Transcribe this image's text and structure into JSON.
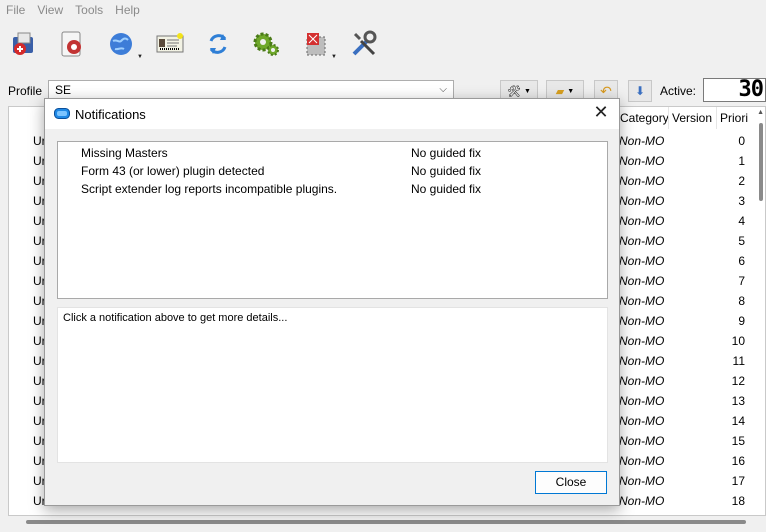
{
  "menu": {
    "items": [
      "File",
      "View",
      "Tools",
      "Help"
    ]
  },
  "toolbar": {
    "icons": [
      "install-mod-icon",
      "nexus-icon",
      "browser-icon",
      "profiles-icon",
      "refresh-icon",
      "settings-gears-icon",
      "executables-icon",
      "tools-icon"
    ]
  },
  "profile": {
    "label": "Profile",
    "value": "SE",
    "active_label": "Active:",
    "active_count": "30"
  },
  "modlist": {
    "columns": {
      "category": "Category",
      "version": "Version",
      "priority": "Priori"
    },
    "name_fragment": "Ur",
    "rows": [
      {
        "cat": "Non-MO",
        "pri": "0"
      },
      {
        "cat": "Non-MO",
        "pri": "1"
      },
      {
        "cat": "Non-MO",
        "pri": "2"
      },
      {
        "cat": "Non-MO",
        "pri": "3"
      },
      {
        "cat": "Non-MO",
        "pri": "4"
      },
      {
        "cat": "Non-MO",
        "pri": "5"
      },
      {
        "cat": "Non-MO",
        "pri": "6"
      },
      {
        "cat": "Non-MO",
        "pri": "7"
      },
      {
        "cat": "Non-MO",
        "pri": "8"
      },
      {
        "cat": "Non-MO",
        "pri": "9"
      },
      {
        "cat": "Non-MO",
        "pri": "10"
      },
      {
        "cat": "Non-MO",
        "pri": "11"
      },
      {
        "cat": "Non-MO",
        "pri": "12"
      },
      {
        "cat": "Non-MO",
        "pri": "13"
      },
      {
        "cat": "Non-MO",
        "pri": "14"
      },
      {
        "cat": "Non-MO",
        "pri": "15"
      },
      {
        "cat": "Non-MO",
        "pri": "16"
      },
      {
        "cat": "Non-MO",
        "pri": "17"
      },
      {
        "cat": "Non-MO",
        "pri": "18"
      }
    ]
  },
  "dialog": {
    "title": "Notifications",
    "notifications": [
      {
        "message": "Missing Masters",
        "fix": "No guided fix"
      },
      {
        "message": "Form 43 (or lower) plugin detected",
        "fix": "No guided fix"
      },
      {
        "message": "Script extender log reports incompatible plugins.",
        "fix": "No guided fix"
      }
    ],
    "details_text": "Click a notification above to get more details...",
    "close_label": "Close"
  },
  "colors": {
    "accent": "#0078d4",
    "window_bg": "#f0f0f0"
  }
}
